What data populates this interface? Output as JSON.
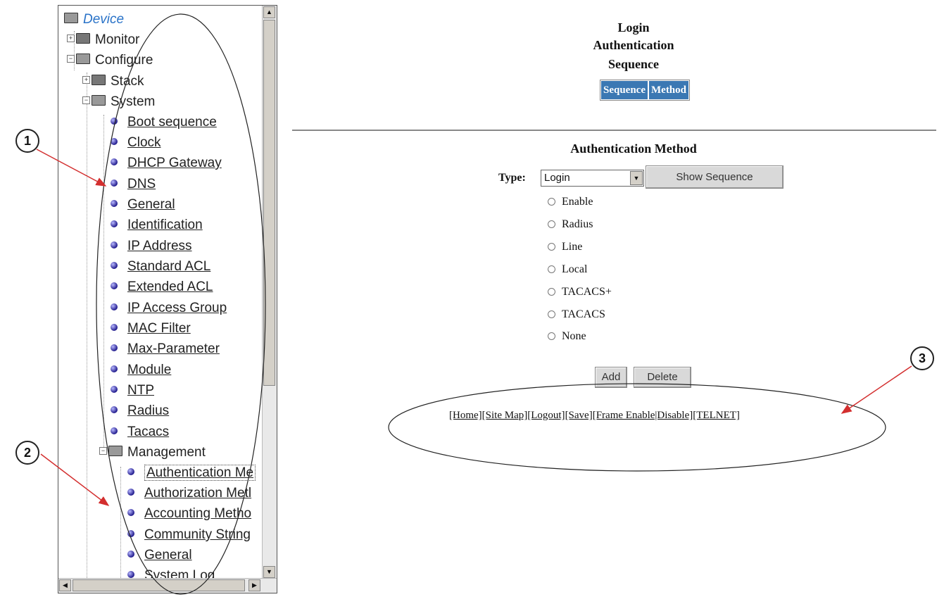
{
  "tree": {
    "root": "Device",
    "monitor": "Monitor",
    "configure": "Configure",
    "stack": "Stack",
    "system": "System",
    "system_items": [
      "Boot sequence",
      "Clock",
      "DHCP Gateway",
      "DNS",
      "General",
      "Identification",
      "IP Address",
      "Standard ACL",
      "Extended ACL",
      "IP Access Group",
      "MAC Filter",
      "Max-Parameter",
      "Module",
      "NTP",
      "Radius",
      "Tacacs"
    ],
    "management": "Management",
    "management_items": [
      "Authentication Me",
      "Authorization Metl",
      "Accounting Metho",
      "Community String",
      "General",
      "System Log"
    ]
  },
  "header": {
    "line1": "Login",
    "line2": "Authentication",
    "line3": "Sequence",
    "tabs": [
      "Sequence",
      "Method"
    ]
  },
  "form": {
    "title": "Authentication Method",
    "type_label": "Type:",
    "type_value": "Login",
    "show_sequence": "Show Sequence",
    "methods": [
      "Enable",
      "Radius",
      "Line",
      "Local",
      "TACACS+",
      "TACACS",
      "None"
    ],
    "add": "Add",
    "delete": "Delete"
  },
  "footer_links": [
    "[Home]",
    "[Site Map]",
    "[Logout]",
    "[Save]",
    "[Frame Enable|Disable]",
    "[TELNET]"
  ],
  "callouts": [
    "1",
    "2",
    "3"
  ]
}
